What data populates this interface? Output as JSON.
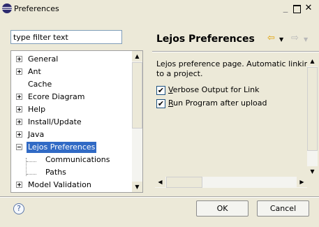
{
  "window": {
    "title": "Preferences"
  },
  "filter": {
    "value": "type filter text"
  },
  "tree": {
    "items": [
      {
        "label": "General",
        "expander": "plus"
      },
      {
        "label": "Ant",
        "expander": "plus"
      },
      {
        "label": "Cache",
        "expander": "none"
      },
      {
        "label": "Ecore Diagram",
        "expander": "plus"
      },
      {
        "label": "Help",
        "expander": "plus"
      },
      {
        "label": "Install/Update",
        "expander": "plus"
      },
      {
        "label": "Java",
        "expander": "plus"
      },
      {
        "label": "Lejos Preferences",
        "expander": "minus",
        "selected": true
      },
      {
        "label": "Communications",
        "expander": "none",
        "child": true
      },
      {
        "label": "Paths",
        "expander": "none",
        "child": true
      },
      {
        "label": "Model Validation",
        "expander": "plus"
      }
    ]
  },
  "page": {
    "title": "Lejos Preferences",
    "description_line1": "Lejos preference page.  Automatic linking",
    "description_line2": "to a project.",
    "options": [
      {
        "mnemonic": "V",
        "rest": "erbose Output for Link",
        "checked": true
      },
      {
        "mnemonic": "R",
        "rest": "un Program after upload",
        "checked": true
      }
    ]
  },
  "buttons": {
    "ok": "OK",
    "cancel": "Cancel",
    "help": "?"
  },
  "icons": {
    "window": "eclipse-icon",
    "back": "back-arrow-icon",
    "forward": "forward-arrow-icon"
  },
  "colors": {
    "selection": "#316ac5",
    "dialog_bg": "#ece9d8",
    "back_arrow": "#e0a000"
  }
}
